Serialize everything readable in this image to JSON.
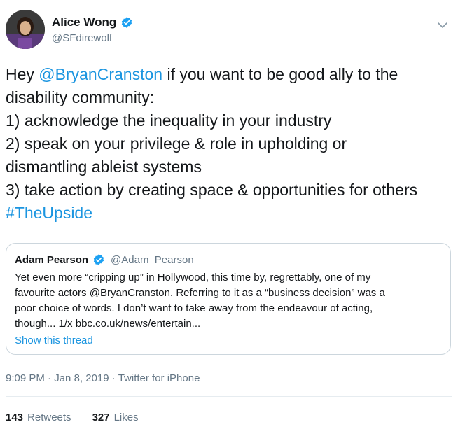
{
  "author": {
    "name": "Alice Wong",
    "handle": "@SFdirewolf"
  },
  "tweet": {
    "lines": [
      [
        {
          "text": "Hey ",
          "link": false
        },
        {
          "text": "@BryanCranston",
          "link": true
        },
        {
          "text": " if you want to be good ally to the",
          "link": false
        }
      ],
      [
        {
          "text": "disability community:",
          "link": false
        }
      ],
      [
        {
          "text": "1) acknowledge the inequality in your industry",
          "link": false
        }
      ],
      [
        {
          "text": "2) speak on your privilege & role in upholding or",
          "link": false
        }
      ],
      [
        {
          "text": "dismantling ableist systems",
          "link": false
        }
      ],
      [
        {
          "text": "3) take action by creating space & opportunities for others",
          "link": false
        }
      ],
      [
        {
          "text": "#TheUpside",
          "link": true
        }
      ]
    ]
  },
  "quoted": {
    "name": "Adam Pearson",
    "handle": "@Adam_Pearson",
    "lines": [
      "Yet even more “cripping up” in Hollywood, this time by, regrettably, one of my",
      "favourite actors @BryanCranston. Referring to it as a “business decision” was a",
      "poor choice of words. I don’t want to take away from the endeavour of acting,",
      "though... 1/x bbc.co.uk/news/entertain..."
    ],
    "show_thread": "Show this thread"
  },
  "meta": {
    "time": "9:09 PM",
    "date": "Jan 8, 2019",
    "source": "Twitter for iPhone",
    "separator": " · "
  },
  "stats": {
    "retweets_count": "143",
    "retweets_label": "Retweets",
    "likes_count": "327",
    "likes_label": "Likes"
  },
  "colors": {
    "link": "#1b95e0",
    "verified": "#1da1f2",
    "muted": "#657786",
    "border": "#ccd6dd"
  },
  "icons": [
    "verified-badge-icon",
    "chevron-down-icon"
  ]
}
